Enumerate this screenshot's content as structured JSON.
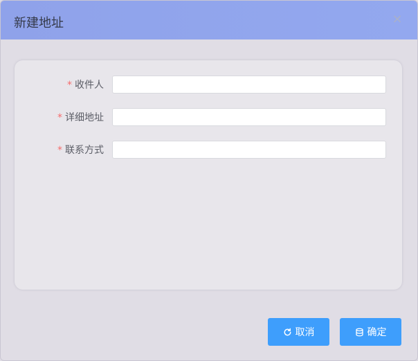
{
  "dialog": {
    "title": "新建地址",
    "close_icon": "close-icon"
  },
  "form": {
    "fields": [
      {
        "label": "收件人",
        "required_mark": "*",
        "value": "",
        "placeholder": ""
      },
      {
        "label": "详细地址",
        "required_mark": "*",
        "value": "",
        "placeholder": ""
      },
      {
        "label": "联系方式",
        "required_mark": "*",
        "value": "",
        "placeholder": ""
      }
    ]
  },
  "footer": {
    "cancel_label": "取消",
    "cancel_icon": "refresh-icon",
    "confirm_label": "确定",
    "confirm_icon": "database-icon"
  },
  "colors": {
    "header_bg": "#8fa2ea",
    "button_bg": "#3e9efc",
    "required": "#f56c6c"
  }
}
